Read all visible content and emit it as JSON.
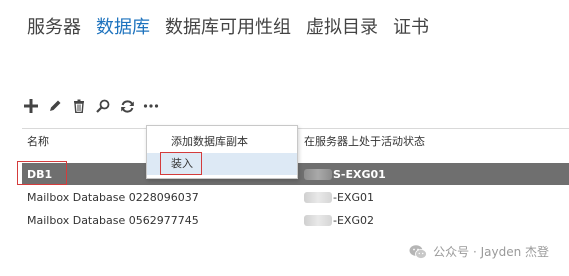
{
  "tabs": [
    {
      "label": "服务器",
      "active": false
    },
    {
      "label": "数据库",
      "active": true
    },
    {
      "label": "数据库可用性组",
      "active": false
    },
    {
      "label": "虚拟目录",
      "active": false
    },
    {
      "label": "证书",
      "active": false
    }
  ],
  "toolbar": {
    "add_icon": "plus-icon",
    "edit_icon": "pencil-icon",
    "delete_icon": "trash-icon",
    "search_icon": "search-icon",
    "refresh_icon": "refresh-icon",
    "more_icon": "more-icon"
  },
  "columns": {
    "name": "名称",
    "server": "在服务器上处于活动状态"
  },
  "rows": [
    {
      "name": "DB1",
      "server": "S-EXG01",
      "selected": true
    },
    {
      "name": "Mailbox Database 0228096037",
      "server": "-EXG01",
      "selected": false
    },
    {
      "name": "Mailbox Database 0562977745",
      "server": "-EXG02",
      "selected": false
    }
  ],
  "context_menu": {
    "items": [
      {
        "label": "添加数据库副本"
      },
      {
        "label": "装入"
      }
    ]
  },
  "watermark": {
    "text": "公众号 · Jayden 杰登"
  },
  "colors": {
    "accent": "#1e73be",
    "selected_row": "#6f6f6f",
    "highlight_border": "#d43c3c",
    "menu_hover": "#dde9f5"
  }
}
